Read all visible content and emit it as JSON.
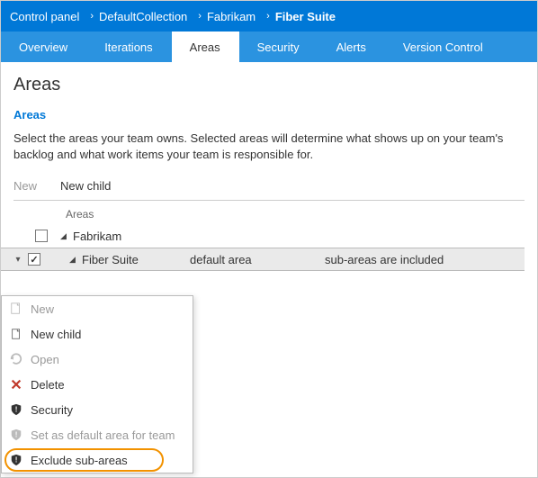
{
  "breadcrumb": {
    "items": [
      "Control panel",
      "DefaultCollection",
      "Fabrikam",
      "Fiber Suite"
    ]
  },
  "tabs": {
    "items": [
      "Overview",
      "Iterations",
      "Areas",
      "Security",
      "Alerts",
      "Version Control"
    ],
    "active": "Areas"
  },
  "page": {
    "title": "Areas",
    "section": "Areas",
    "description": "Select the areas your team owns. Selected areas will determine what shows up on your team's backlog and what work items your team is responsible for."
  },
  "toolbar": {
    "new": "New",
    "new_child": "New child"
  },
  "tree": {
    "header": "Areas",
    "rows": [
      {
        "label": "Fabrikam",
        "checked": false,
        "expanded": true
      },
      {
        "label": "Fiber Suite",
        "checked": true,
        "expanded": true,
        "col2": "default area",
        "col3": "sub-areas are included",
        "selected": true
      }
    ]
  },
  "context_menu": {
    "items": [
      {
        "icon": "new-icon",
        "label": "New",
        "disabled": true
      },
      {
        "icon": "new-child-icon",
        "label": "New child"
      },
      {
        "icon": "open-icon",
        "label": "Open",
        "disabled": true
      },
      {
        "icon": "delete-icon",
        "label": "Delete"
      },
      {
        "icon": "security-icon",
        "label": "Security"
      },
      {
        "icon": "default-area-icon",
        "label": "Set as default area for team",
        "disabled": true
      },
      {
        "icon": "exclude-icon",
        "label": "Exclude sub-areas",
        "highlight": true
      }
    ]
  }
}
